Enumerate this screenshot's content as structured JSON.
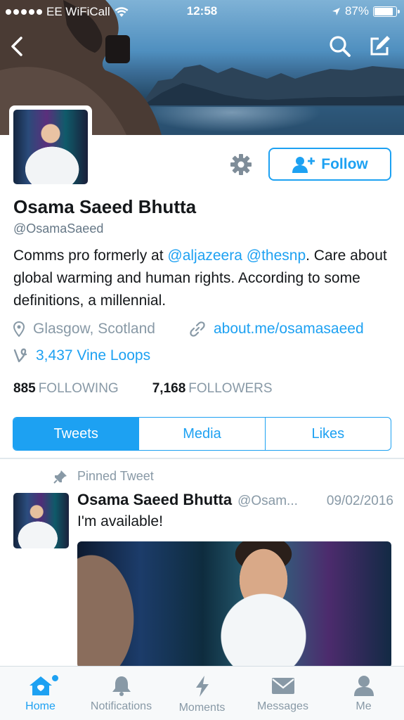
{
  "status_bar": {
    "carrier": "EE WiFiCall",
    "time": "12:58",
    "battery": "87%",
    "battery_level": 0.87
  },
  "profile": {
    "name": "Osama Saeed Bhutta",
    "handle": "@OsamaSaeed",
    "bio_prefix": "Comms pro formerly at ",
    "bio_mention_1": "@aljazeera",
    "bio_space": " ",
    "bio_mention_2": "@thesnp",
    "bio_suffix": ". Care about global warming and human rights. According to some definitions, a millennial.",
    "location": "Glasgow, Scotland",
    "website": "about.me/osamasaeed",
    "vine_loops": "3,437 Vine Loops",
    "following_count": "885",
    "following_label": "FOLLOWING",
    "followers_count": "7,168",
    "followers_label": "FOLLOWERS",
    "follow_label": "Follow"
  },
  "tabs": [
    {
      "label": "Tweets",
      "active": true
    },
    {
      "label": "Media",
      "active": false
    },
    {
      "label": "Likes",
      "active": false
    }
  ],
  "tweet": {
    "pinned_label": "Pinned Tweet",
    "author": "Osama Saeed Bhutta",
    "handle": "@Osam...",
    "date": "09/02/2016",
    "text": "I'm available!"
  },
  "tabbar": [
    {
      "label": "Home",
      "icon": "home-icon",
      "active": true
    },
    {
      "label": "Notifications",
      "icon": "bell-icon",
      "active": false
    },
    {
      "label": "Moments",
      "icon": "lightning-icon",
      "active": false
    },
    {
      "label": "Messages",
      "icon": "envelope-icon",
      "active": false
    },
    {
      "label": "Me",
      "icon": "person-icon",
      "active": false
    }
  ],
  "colors": {
    "accent": "#1da1f2",
    "muted": "#8899a6",
    "text": "#14171a"
  }
}
